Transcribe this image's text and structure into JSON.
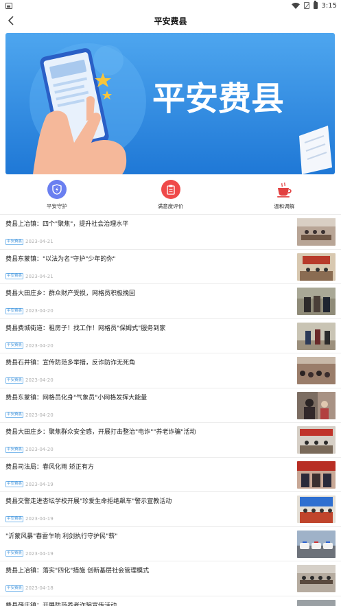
{
  "status_bar": {
    "time": "3:15"
  },
  "nav": {
    "title": "平安费县"
  },
  "banner": {
    "text": "平安费县"
  },
  "quick_actions": [
    {
      "label": "平安守护",
      "color": "#6a7ff0",
      "icon": "shield-icon"
    },
    {
      "label": "满意度评价",
      "color": "#ef4a4a",
      "icon": "clipboard-icon"
    },
    {
      "label": "温和调解",
      "color": "#e24040",
      "icon": "teacup-icon"
    }
  ],
  "news": [
    {
      "title": "费县上冶镇：四个\"聚焦\"，提升社会治理水平",
      "tag": "平安费县",
      "date": "2023-04-21"
    },
    {
      "title": "费县东蒙镇：\"以法为名\"守护\"少年的你\"",
      "tag": "平安费县",
      "date": "2023-04-21"
    },
    {
      "title": "费县大田庄乡：群众财产受损，网格员积极挽回",
      "tag": "平安费县",
      "date": "2023-04-20"
    },
    {
      "title": "费县费城街道：租房子！找工作！网格员\"保姆式\"服务到家",
      "tag": "平安费县",
      "date": "2023-04-20"
    },
    {
      "title": "费县石井镇：宣传防范多举措，反诈防诈无死角",
      "tag": "平安费县",
      "date": "2023-04-20"
    },
    {
      "title": "费县东蒙镇：网格员化身\"气象员\"小网格发挥大能量",
      "tag": "平安费县",
      "date": "2023-04-20"
    },
    {
      "title": "费县大田庄乡：聚焦群众安全感，开展打击整治\"电诈\"\"养老诈骗\"活动",
      "tag": "平安费县",
      "date": "2023-04-20"
    },
    {
      "title": "费县司法局：春风化雨 矫正有方",
      "tag": "平安费县",
      "date": "2023-04-19"
    },
    {
      "title": "费县交警走进杏坛学校开展\"珍爱生命拒绝飙车\"警示宣教活动",
      "tag": "平安费县",
      "date": "2023-04-19"
    },
    {
      "title": "\"沂蒙风暴\"春雷乍响 利剑执行守护民\"薪\"",
      "tag": "平安费县",
      "date": "2023-04-19"
    },
    {
      "title": "费县上冶镇：落实\"四化\"措施 创新基层社会管理模式",
      "tag": "平安费县",
      "date": "2023-04-18"
    },
    {
      "title": "费县薛庄镇：开展防范养老诈骗宣传活动",
      "tag": "",
      "date": ""
    }
  ]
}
